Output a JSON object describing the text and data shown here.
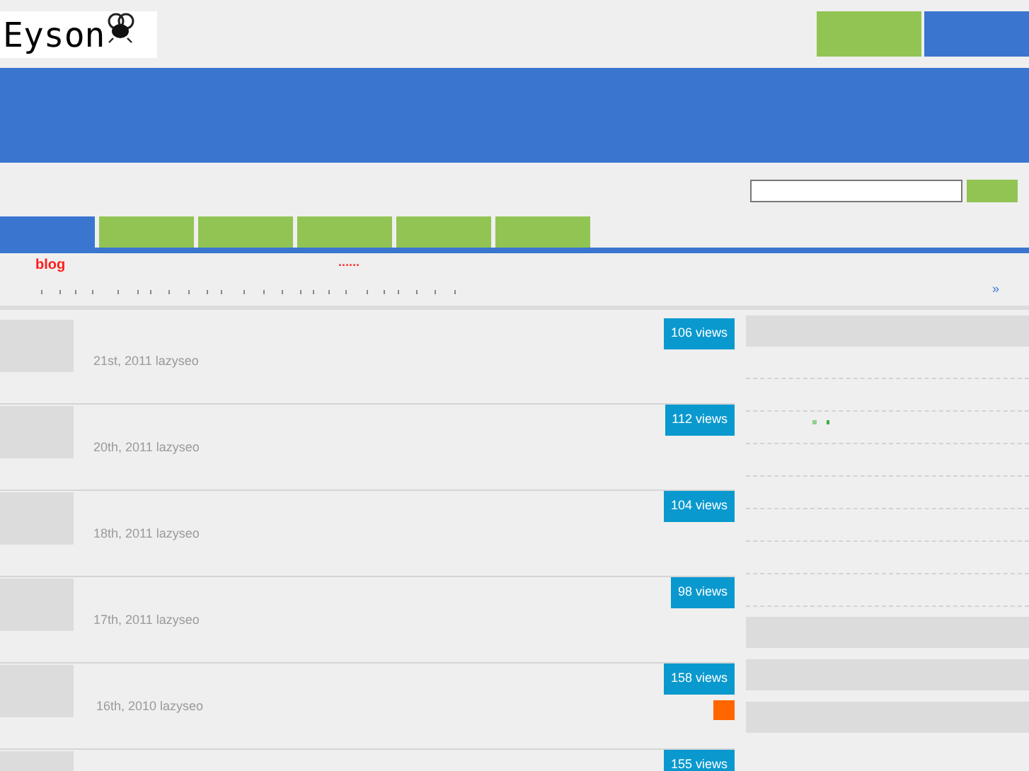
{
  "logo": {
    "text": "Eyson"
  },
  "nav_tabs": [
    {
      "selected": true
    },
    {
      "selected": false
    },
    {
      "selected": false
    },
    {
      "selected": false
    },
    {
      "selected": false
    },
    {
      "selected": false
    }
  ],
  "breadcrumb": {
    "label": "blog",
    "dots": "......",
    "next": "»"
  },
  "posts": [
    {
      "views": "106 views",
      "meta": "21st, 2011 lazyseo",
      "feed_icon": false
    },
    {
      "views": "112 views",
      "meta": "20th, 2011 lazyseo",
      "feed_icon": false
    },
    {
      "views": "104 views",
      "meta": "18th, 2011 lazyseo",
      "feed_icon": false
    },
    {
      "views": "98 views",
      "meta": "17th, 2011 lazyseo",
      "feed_icon": false
    },
    {
      "views": "158 views",
      "meta": "16th, 2010 lazyseo",
      "feed_icon": true
    },
    {
      "views": "155 views"
    }
  ]
}
